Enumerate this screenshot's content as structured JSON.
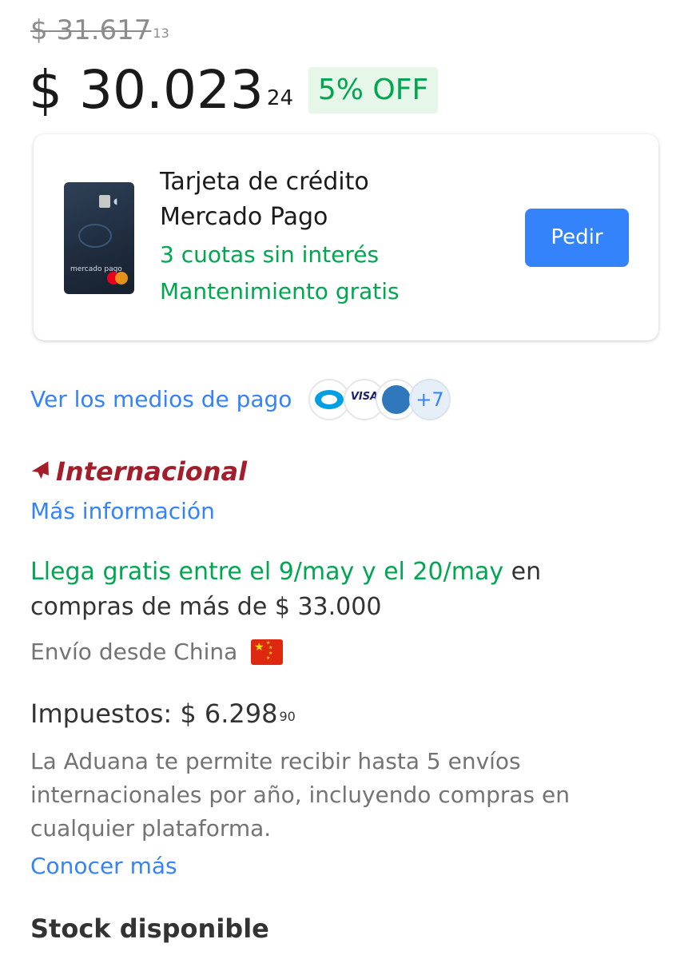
{
  "pricing": {
    "original_currency": "$",
    "original_main": "31.617",
    "original_cents": "13",
    "currency": "$",
    "price_main": "30.023",
    "price_cents": "24",
    "discount": "5% OFF"
  },
  "credit_card_offer": {
    "title_line1": "Tarjeta de crédito",
    "title_line2": "Mercado Pago",
    "benefit_1": "3 cuotas sin interés",
    "benefit_2": "Mantenimiento gratis",
    "button_label": "Pedir",
    "card_brand_text": "mercado pago"
  },
  "payment_methods": {
    "link_label": "Ver los medios de pago",
    "icons": [
      "mercadopago-icon",
      "visa-icon",
      "amex-icon"
    ],
    "visa_text": "VISA",
    "more_count": "+7"
  },
  "international": {
    "label": "Internacional",
    "more_info_link": "Más información"
  },
  "delivery": {
    "highlight": "Llega gratis entre el 9/may y el 20/may",
    "rest": " en compras de más de $ 33.000",
    "ships_from": "Envío desde China",
    "flag_icon": "china-flag-icon"
  },
  "taxes": {
    "label": "Impuestos: $ 6.298",
    "cents": "90",
    "customs_note": "La Aduana te permite recibir hasta 5 envíos internacionales por año, incluyendo compras en cualquier plataforma.",
    "learn_more_link": "Conocer más"
  },
  "stock": {
    "label": "Stock disponible"
  },
  "colors": {
    "accent_blue": "#3483fa",
    "success_green": "#00a650",
    "international_red": "#a41d2b",
    "discount_bg": "#e6f7ea"
  }
}
